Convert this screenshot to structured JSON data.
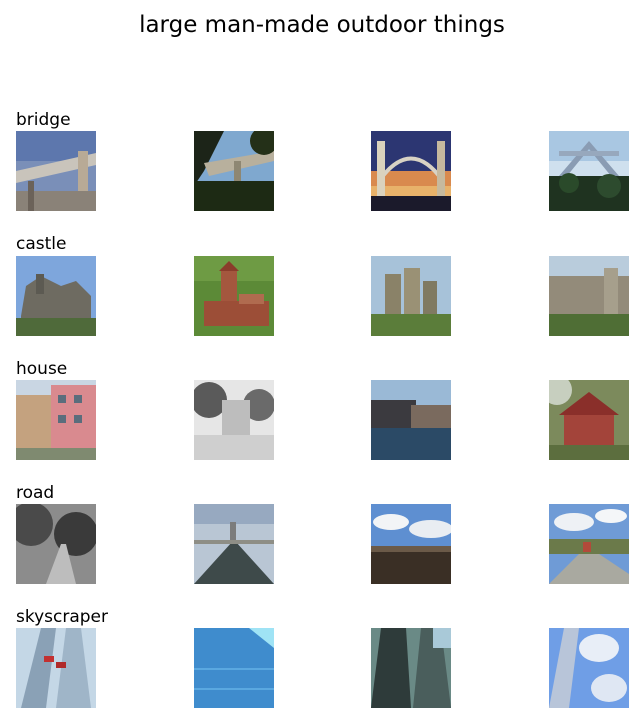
{
  "title": "large man-made outdoor things",
  "rows": [
    {
      "label": "bridge",
      "images": [
        "bridge-overpass",
        "bridge-underside",
        "bridge-arch-sunset",
        "bridge-truss-sky"
      ]
    },
    {
      "label": "castle",
      "images": [
        "castle-stone",
        "castle-red-tower",
        "castle-round-towers",
        "castle-wall-lawn"
      ]
    },
    {
      "label": "house",
      "images": [
        "house-pink-apartment",
        "house-bw-tree",
        "house-waterfront",
        "house-red-cabin"
      ]
    },
    {
      "label": "road",
      "images": [
        "road-bw-forest",
        "road-bridge-horizon",
        "road-sky-clouds",
        "road-open-landscape"
      ]
    },
    {
      "label": "skyscraper",
      "images": [
        "skyscraper-flags",
        "skyscraper-glass-blue",
        "skyscraper-dark",
        "skyscraper-clouds"
      ]
    }
  ]
}
